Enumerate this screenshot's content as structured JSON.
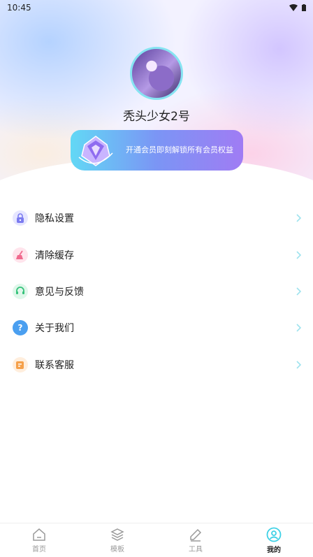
{
  "status_bar": {
    "time": "10:45"
  },
  "profile": {
    "username": "秃头少女2号"
  },
  "vip_banner": {
    "text": "开通会员即刻解锁所有会员权益"
  },
  "menu": {
    "items": [
      {
        "label": "隐私设置",
        "icon": "lock-icon",
        "color": "#7b7bf0"
      },
      {
        "label": "清除缓存",
        "icon": "broom-icon",
        "color": "#f06a8e"
      },
      {
        "label": "意见与反馈",
        "icon": "headset-icon",
        "color": "#35c27a"
      },
      {
        "label": "关于我们",
        "icon": "question-icon",
        "color": "#4a9ff0"
      },
      {
        "label": "联系客服",
        "icon": "edit-note-icon",
        "color": "#f5a04a"
      }
    ]
  },
  "tabbar": {
    "tabs": [
      {
        "label": "首页",
        "icon": "home-icon"
      },
      {
        "label": "模板",
        "icon": "layers-icon"
      },
      {
        "label": "工具",
        "icon": "pen-icon"
      },
      {
        "label": "我的",
        "icon": "user-circle-icon",
        "active": true
      }
    ]
  },
  "colors": {
    "accent": "#3fd1e6",
    "chevron": "#9fe3ee"
  }
}
